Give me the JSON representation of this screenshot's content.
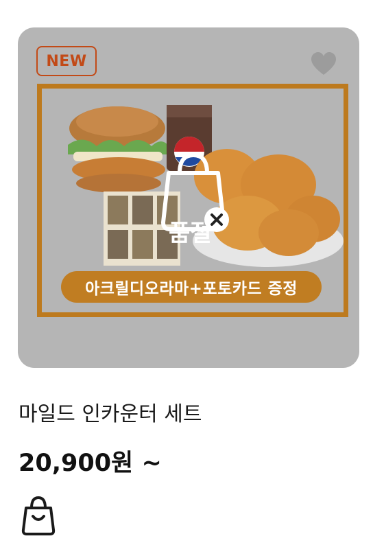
{
  "product": {
    "badge": "NEW",
    "promo_text": "아크릴디오라마+포토카드 증정",
    "soldout_label": "품절",
    "name": "마일드 인카운터 세트",
    "price": "20,900원 ~"
  },
  "icons": {
    "favorite": "heart-icon",
    "soldout": "shopping-bag-x-icon",
    "cart": "shopping-bag-icon"
  },
  "colors": {
    "card_bg": "#b5b5b5",
    "badge": "#c24a17",
    "promo_frame": "#bd7a1e",
    "promo_banner": "#c07d22"
  }
}
